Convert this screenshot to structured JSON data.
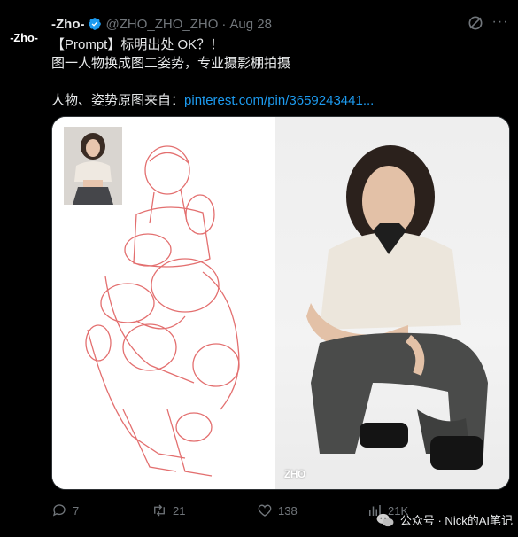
{
  "author": {
    "avatar_text": "-Zho-",
    "display_name": "-Zho-",
    "handle": "@ZHO_ZHO_ZHO",
    "separator": "·",
    "date": "Aug 28"
  },
  "post": {
    "line1": "【Prompt】标明出处 OK？！",
    "line2": "图一人物换成图二姿势，专业摄影棚拍摄",
    "line3_prefix": "人物、姿势原图来自：",
    "line3_link": "pinterest.com/pin/3659243441..."
  },
  "media": {
    "watermark": "ZHO"
  },
  "actions": {
    "replies": "7",
    "reposts": "21",
    "likes": "138",
    "views": "21K"
  },
  "overlay": {
    "wechat_label": "公众号 · Nick的AI笔记"
  },
  "colors": {
    "background": "#000000",
    "text": "#e7e9ea",
    "muted": "#71767b",
    "link": "#1d9bf0",
    "verified": "#1d9bf0",
    "sketch": "#e06060"
  }
}
